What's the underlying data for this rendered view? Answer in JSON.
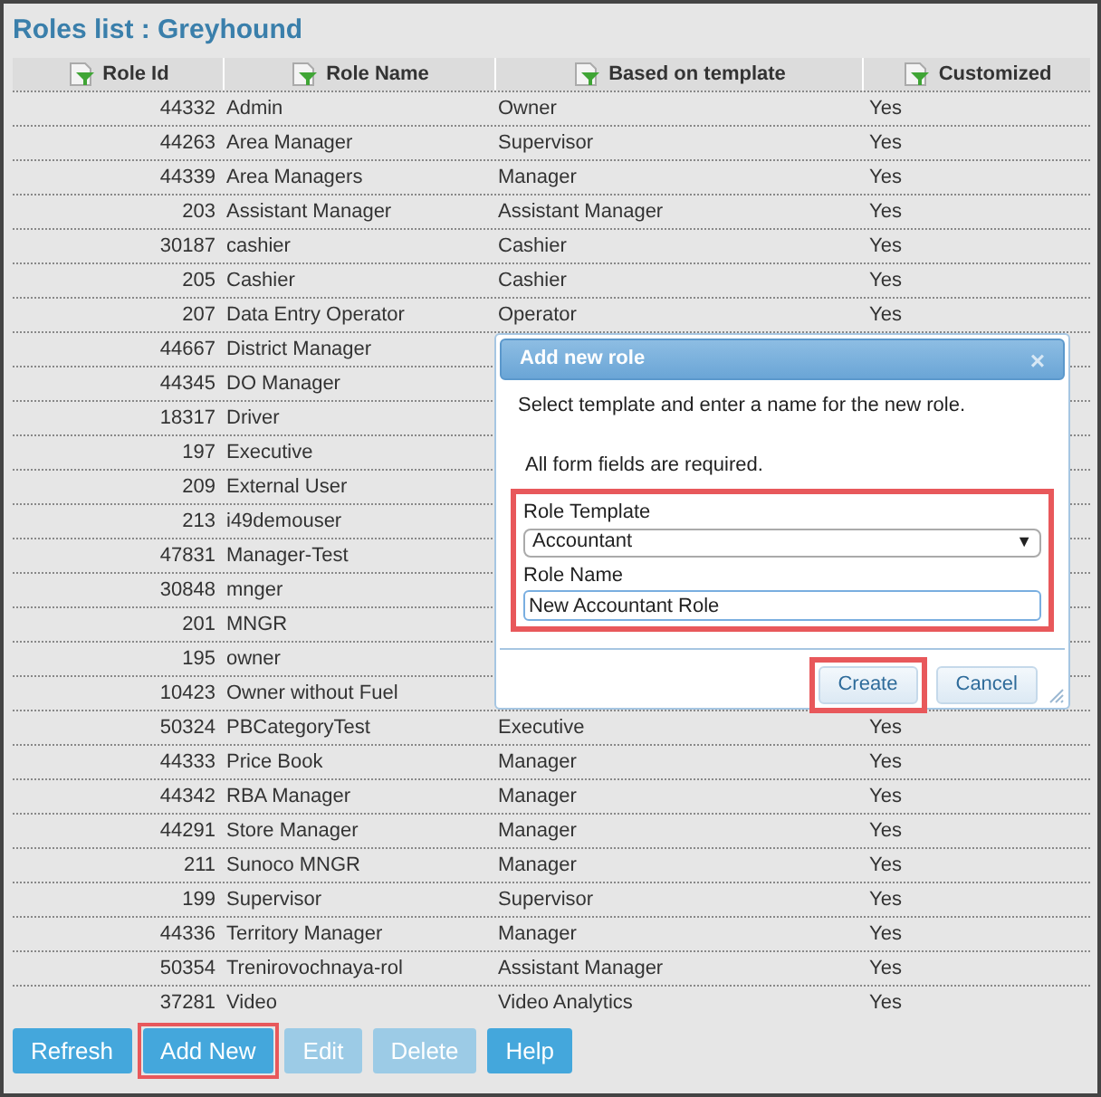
{
  "page": {
    "title": "Roles list : Greyhound"
  },
  "table": {
    "columns": [
      {
        "label": "Role Id"
      },
      {
        "label": "Role Name"
      },
      {
        "label": "Based on template"
      },
      {
        "label": "Customized"
      }
    ],
    "rows": [
      {
        "id": "44332",
        "name": "Admin",
        "template": "Owner",
        "customized": "Yes"
      },
      {
        "id": "44263",
        "name": "Area Manager",
        "template": "Supervisor",
        "customized": "Yes"
      },
      {
        "id": "44339",
        "name": "Area Managers",
        "template": "Manager",
        "customized": "Yes"
      },
      {
        "id": "203",
        "name": "Assistant Manager",
        "template": "Assistant Manager",
        "customized": "Yes"
      },
      {
        "id": "30187",
        "name": "cashier",
        "template": "Cashier",
        "customized": "Yes"
      },
      {
        "id": "205",
        "name": "Cashier",
        "template": "Cashier",
        "customized": "Yes"
      },
      {
        "id": "207",
        "name": "Data Entry Operator",
        "template": "Operator",
        "customized": "Yes"
      },
      {
        "id": "44667",
        "name": "District Manager"
      },
      {
        "id": "44345",
        "name": "DO Manager"
      },
      {
        "id": "18317",
        "name": "Driver"
      },
      {
        "id": "197",
        "name": "Executive"
      },
      {
        "id": "209",
        "name": "External User"
      },
      {
        "id": "213",
        "name": "i49demouser"
      },
      {
        "id": "47831",
        "name": "Manager-Test"
      },
      {
        "id": "30848",
        "name": "mnger"
      },
      {
        "id": "201",
        "name": "MNGR"
      },
      {
        "id": "195",
        "name": "owner"
      },
      {
        "id": "10423",
        "name": "Owner without Fuel"
      },
      {
        "id": "50324",
        "name": "PBCategoryTest",
        "template": "Executive",
        "customized": "Yes"
      },
      {
        "id": "44333",
        "name": "Price Book",
        "template": "Manager",
        "customized": "Yes"
      },
      {
        "id": "44342",
        "name": "RBA Manager",
        "template": "Manager",
        "customized": "Yes"
      },
      {
        "id": "44291",
        "name": "Store Manager",
        "template": "Manager",
        "customized": "Yes"
      },
      {
        "id": "211",
        "name": "Sunoco MNGR",
        "template": "Manager",
        "customized": "Yes"
      },
      {
        "id": "199",
        "name": "Supervisor",
        "template": "Supervisor",
        "customized": "Yes"
      },
      {
        "id": "44336",
        "name": "Territory Manager",
        "template": "Manager",
        "customized": "Yes"
      },
      {
        "id": "50354",
        "name": "Trenirovochnaya-rol",
        "template": "Assistant Manager",
        "customized": "Yes"
      },
      {
        "id": "37281",
        "name": "Video",
        "template": "Video Analytics",
        "customized": "Yes"
      }
    ]
  },
  "buttons": [
    {
      "label": "Refresh",
      "disabled": false,
      "highlighted": false
    },
    {
      "label": "Add New",
      "disabled": false,
      "highlighted": true
    },
    {
      "label": "Edit",
      "disabled": true,
      "highlighted": false
    },
    {
      "label": "Delete",
      "disabled": true,
      "highlighted": false
    },
    {
      "label": "Help",
      "disabled": false,
      "highlighted": false
    }
  ],
  "dialog": {
    "title": "Add new role",
    "close": "×",
    "intro": "Select template and enter a name for the new role.",
    "note": "All form fields are required.",
    "form_highlighted": true,
    "template_label": "Role Template",
    "template_value": "Accountant",
    "template_arrow": "▼",
    "name_label": "Role Name",
    "name_value": "New Accountant Role",
    "buttons": [
      {
        "label": "Create",
        "highlighted": true
      },
      {
        "label": "Cancel",
        "highlighted": false
      }
    ]
  }
}
